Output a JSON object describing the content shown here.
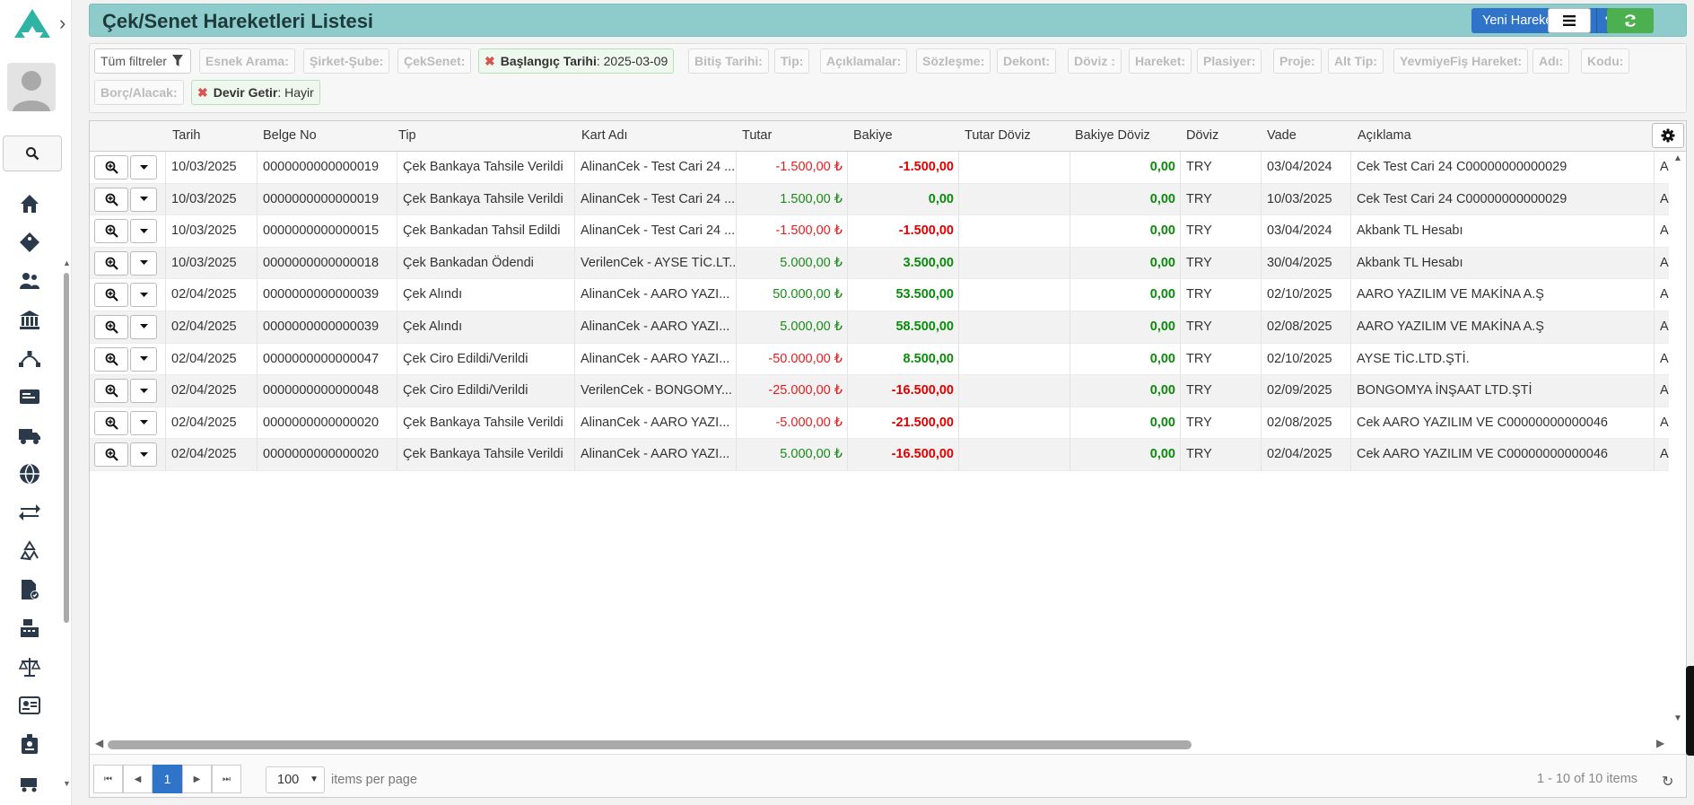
{
  "page": {
    "title": "Çek/Senet Hareketleri Listesi"
  },
  "toolbar": {
    "new_label": "Yeni Hareket Ekle"
  },
  "filters": {
    "all_label": "Tüm filtreler",
    "chips": [
      "Esnek Arama:",
      "Şirket-Şube:",
      "ÇekSenet:",
      "Bitiş Tarihi:",
      "Tip:",
      "Açıklamalar:",
      "Sözleşme:",
      "Dekont:",
      "Döviz :",
      "Hareket:",
      "Plasiyer:",
      "Proje:",
      "Alt Tip:",
      "YevmiyeFiş Hareket:",
      "Adı:",
      "Kodu:",
      "Borç/Alacak:"
    ],
    "active": [
      {
        "label": "Başlangıç Tarihi",
        "value": ": 2025-03-09"
      },
      {
        "label": "Devir Getir",
        "value": ": Hayir"
      }
    ]
  },
  "grid": {
    "columns": [
      "Tarih",
      "Belge No",
      "Tip",
      "Kart Adı",
      "Tutar",
      "Bakiye",
      "Tutar Döviz",
      "Bakiye Döviz",
      "Döviz",
      "Vade",
      "Açıklama"
    ],
    "rows": [
      {
        "tarih": "10/03/2025",
        "belge": "0000000000000019",
        "tip": "Çek Bankaya Tahsile Verildi",
        "kart": "AlinanCek - Test Cari 24 ...",
        "tutar": "-1.500,00 ₺",
        "tutar_sign": "neg",
        "bakiye": "-1.500,00",
        "bakiye_sign": "neg",
        "tutar_doviz": "",
        "bakiye_doviz": "0,00",
        "doviz": "TRY",
        "vade": "03/04/2024",
        "aciklama": "Cek Test Cari 24 C00000000000029",
        "extra": "A"
      },
      {
        "tarih": "10/03/2025",
        "belge": "0000000000000019",
        "tip": "Çek Bankaya Tahsile Verildi",
        "kart": "AlinanCek - Test Cari 24 ...",
        "tutar": "1.500,00 ₺",
        "tutar_sign": "pos",
        "bakiye": "0,00",
        "bakiye_sign": "pos",
        "tutar_doviz": "",
        "bakiye_doviz": "0,00",
        "doviz": "TRY",
        "vade": "10/03/2025",
        "aciklama": "Cek Test Cari 24 C00000000000029",
        "extra": "A"
      },
      {
        "tarih": "10/03/2025",
        "belge": "0000000000000015",
        "tip": "Çek Bankadan Tahsil Edildi",
        "kart": "AlinanCek - Test Cari 24 ...",
        "tutar": "-1.500,00 ₺",
        "tutar_sign": "neg",
        "bakiye": "-1.500,00",
        "bakiye_sign": "neg",
        "tutar_doviz": "",
        "bakiye_doviz": "0,00",
        "doviz": "TRY",
        "vade": "03/04/2024",
        "aciklama": "Akbank TL Hesabı",
        "extra": "A"
      },
      {
        "tarih": "10/03/2025",
        "belge": "0000000000000018",
        "tip": "Çek Bankadan Ödendi",
        "kart": "VerilenCek - AYSE TİC.LT...",
        "tutar": "5.000,00 ₺",
        "tutar_sign": "pos",
        "bakiye": "3.500,00",
        "bakiye_sign": "pos",
        "tutar_doviz": "",
        "bakiye_doviz": "0,00",
        "doviz": "TRY",
        "vade": "30/04/2025",
        "aciklama": "Akbank TL Hesabı",
        "extra": "A"
      },
      {
        "tarih": "02/04/2025",
        "belge": "0000000000000039",
        "tip": "Çek Alındı",
        "kart": "AlinanCek - AARO YAZI...",
        "tutar": "50.000,00 ₺",
        "tutar_sign": "pos",
        "bakiye": "53.500,00",
        "bakiye_sign": "pos",
        "tutar_doviz": "",
        "bakiye_doviz": "0,00",
        "doviz": "TRY",
        "vade": "02/10/2025",
        "aciklama": "AARO YAZILIM VE MAKİNA A.Ş",
        "extra": "A"
      },
      {
        "tarih": "02/04/2025",
        "belge": "0000000000000039",
        "tip": "Çek Alındı",
        "kart": "AlinanCek - AARO YAZI...",
        "tutar": "5.000,00 ₺",
        "tutar_sign": "pos",
        "bakiye": "58.500,00",
        "bakiye_sign": "pos",
        "tutar_doviz": "",
        "bakiye_doviz": "0,00",
        "doviz": "TRY",
        "vade": "02/08/2025",
        "aciklama": "AARO YAZILIM VE MAKİNA A.Ş",
        "extra": "A"
      },
      {
        "tarih": "02/04/2025",
        "belge": "0000000000000047",
        "tip": "Çek Ciro Edildi/Verildi",
        "kart": "AlinanCek - AARO YAZI...",
        "tutar": "-50.000,00 ₺",
        "tutar_sign": "neg",
        "bakiye": "8.500,00",
        "bakiye_sign": "pos",
        "tutar_doviz": "",
        "bakiye_doviz": "0,00",
        "doviz": "TRY",
        "vade": "02/10/2025",
        "aciklama": "AYSE TİC.LTD.ŞTİ.",
        "extra": "A"
      },
      {
        "tarih": "02/04/2025",
        "belge": "0000000000000048",
        "tip": "Çek Ciro Edildi/Verildi",
        "kart": "VerilenCek - BONGOMY...",
        "tutar": "-25.000,00 ₺",
        "tutar_sign": "neg",
        "bakiye": "-16.500,00",
        "bakiye_sign": "neg",
        "tutar_doviz": "",
        "bakiye_doviz": "0,00",
        "doviz": "TRY",
        "vade": "02/09/2025",
        "aciklama": "BONGOMYA İNŞAAT LTD.ŞTİ",
        "extra": "A"
      },
      {
        "tarih": "02/04/2025",
        "belge": "0000000000000020",
        "tip": "Çek Bankaya Tahsile Verildi",
        "kart": "AlinanCek - AARO YAZI...",
        "tutar": "-5.000,00 ₺",
        "tutar_sign": "neg",
        "bakiye": "-21.500,00",
        "bakiye_sign": "neg",
        "tutar_doviz": "",
        "bakiye_doviz": "0,00",
        "doviz": "TRY",
        "vade": "02/08/2025",
        "aciklama": "Cek AARO YAZILIM VE C00000000000046",
        "extra": "A"
      },
      {
        "tarih": "02/04/2025",
        "belge": "0000000000000020",
        "tip": "Çek Bankaya Tahsile Verildi",
        "kart": "AlinanCek - AARO YAZI...",
        "tutar": "5.000,00 ₺",
        "tutar_sign": "pos",
        "bakiye": "-16.500,00",
        "bakiye_sign": "neg",
        "tutar_doviz": "",
        "bakiye_doviz": "0,00",
        "doviz": "TRY",
        "vade": "02/04/2025",
        "aciklama": "Cek AARO YAZILIM VE C00000000000046",
        "extra": "A"
      }
    ]
  },
  "pager": {
    "current_page": "1",
    "page_size": "100",
    "items_per_page_label": "items per page",
    "info": "1 - 10 of 10 items"
  },
  "sidebar": {
    "icons": [
      "home-icon",
      "tag-icon",
      "users-icon",
      "bank-icon",
      "bezier-icon",
      "id-card-icon",
      "truck-icon",
      "globe-icon",
      "transfer-icon",
      "recycle-icon",
      "file-check-icon",
      "cash-register-icon",
      "scale-icon",
      "address-card-icon",
      "badge-icon",
      "cart-icon"
    ]
  },
  "colors": {
    "accent": "#2f74c8",
    "title_bar": "#8ecbcb",
    "refresh": "#4caf50",
    "negative": "#e02020",
    "positive": "#1a8a1a"
  }
}
